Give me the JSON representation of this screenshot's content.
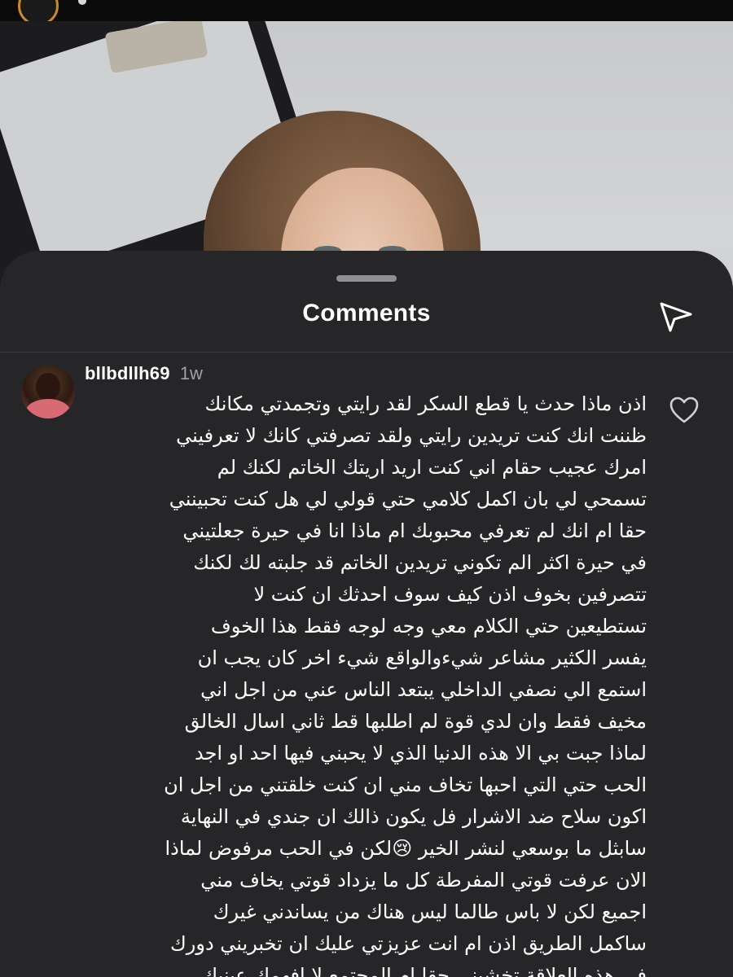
{
  "post": {
    "image_alt": "post-image"
  },
  "sheet": {
    "title": "Comments"
  },
  "comment": {
    "username": "bllbdllh69",
    "time": "1w",
    "text": "اذن ماذا حدث يا قطع السكر لقد رايتي وتجمدتي مكانك\nظننت انك كنت تريدين رايتي ولقد تصرفتي كانك لا تعرفيني\nامرك عجيب حقام اني كنت اريد اريتك الخاتم لكنك لم\nتسمحي لي بان اكمل كلامي حتي قولي لي هل كنت تحبينني\nحقا  ام انك لم تعرفي محبوبك ام ماذا انا في حيرة جعلتيني\nفي حيرة اكثر الم تكوني تريدين الخاتم قد جلبته لك لكنك\nتتصرفين بخوف اذن كيف سوف احدثك ان كنت لا\nتستطيعين حتي الكلام معي وجه لوجه فقط هذا الخوف\nيفسر الكثير مشاعر شيءوالواقع شيء اخر كان يجب ان\nاستمع الي نصفي الداخلي يبتعد الناس عني من اجل اني\nمخيف فقط وان لدي قوة لم اطلبها قط ثاني اسال الخالق\nلماذا جبت بي الا هذه الدنيا الذي لا يحبني فيها احد او اجد\nالحب حتي التي احبها تخاف مني ان كنت خلقتني من اجل ان\nاكون سلاح ضد الاشرار  فل يكون ذالك ان جندي في النهاية\nسابثل ما بوسعي لنشر الخير 😢لكن في الحب مرفوض لماذا\nالان عرفت قوتي المفرطة كل ما يزداد قوتي يخاف مني\nاجميع لكن لا باس طالما ليس هناك من يساندني غيرك\nساكمل الطريق اذن ام انت عزيزتي عليك ان تخبريني دورك\nفي هذه العلاقة تخشيني حقا ام المجتمع لا افهمك عينيك\nتقول الكثير لكن صمتك اكثر غرابة ان كنت لا تريدنني لا باس"
  },
  "icons": {
    "share": "paper-plane-icon",
    "like": "heart-icon"
  },
  "colors": {
    "sheet_bg": "#262629",
    "text": "#ffffff",
    "secondary_text": "#a1a1a6"
  }
}
